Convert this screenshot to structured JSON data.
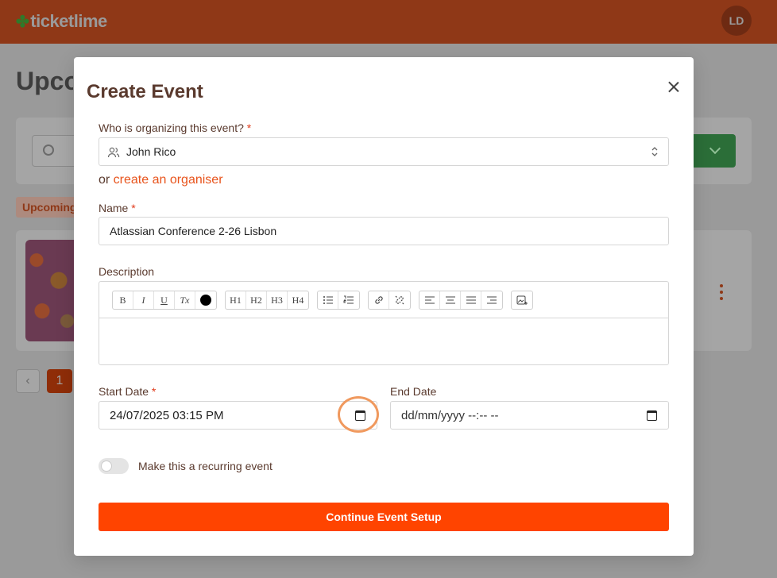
{
  "app": {
    "logo_text": "ticketlime",
    "avatar_initials": "LD"
  },
  "background": {
    "page_title": "Upcoming Events",
    "tab_label": "Upcoming",
    "pager_prev": "‹",
    "pager_current": "1"
  },
  "modal": {
    "title": "Create Event",
    "organizer": {
      "label": "Who is organizing this event?",
      "required_mark": "*",
      "value": "John Rico",
      "or_text": "or ",
      "create_link": "create an organiser"
    },
    "name": {
      "label": "Name",
      "required_mark": "*",
      "value": "Atlassian Conference 2-26 Lisbon"
    },
    "description": {
      "label": "Description",
      "toolbar": {
        "bold": "B",
        "italic": "I",
        "underline": "U",
        "clear_format": "Tx",
        "h1": "H1",
        "h2": "H2",
        "h3": "H3",
        "h4": "H4"
      }
    },
    "start_date": {
      "label": "Start Date",
      "required_mark": "*",
      "value": "24/07/2025 03:15 PM"
    },
    "end_date": {
      "label": "End Date",
      "value": "dd/mm/yyyy --:-- --"
    },
    "recurring": {
      "label": "Make this a recurring event",
      "enabled": false
    },
    "continue_button": "Continue Event Setup"
  },
  "colors": {
    "accent": "#ff4400",
    "link": "#e8531b",
    "required": "#e03a1a",
    "highlight_ring": "#f0995e"
  }
}
